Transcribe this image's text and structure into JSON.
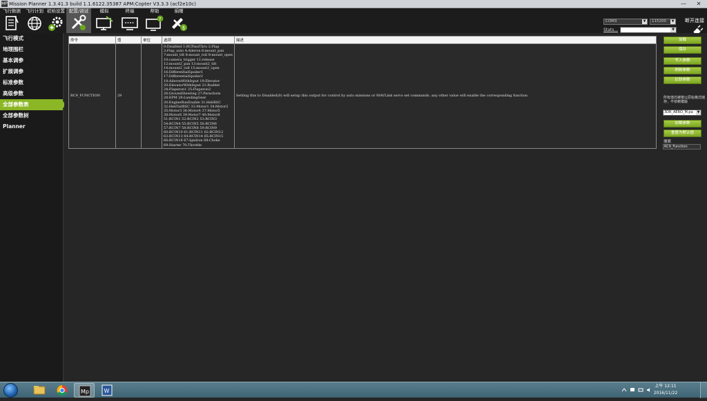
{
  "window": {
    "title": "Mission Planner 1.3.41.3 build 1.1.6122.35387 APM:Copter V3.3.3 (acf2e10c)",
    "app_icon": "MP",
    "min_glyph": "—",
    "close_glyph": "✕"
  },
  "menu": {
    "items": [
      {
        "label": "飞行数据",
        "icon": "flight-data-icon"
      },
      {
        "label": "飞行计划",
        "icon": "globe-icon"
      },
      {
        "label": "初始设置",
        "icon": "initial-setup-icon"
      },
      {
        "label": "配置/调试",
        "icon": "config-tuning-icon"
      },
      {
        "label": "模拟",
        "icon": "simulation-icon"
      },
      {
        "label": "终端",
        "icon": "terminal-icon"
      },
      {
        "label": "帮助",
        "icon": "help-icon"
      },
      {
        "label": "捐赠",
        "icon": "donate-icon"
      }
    ],
    "active_index": 3
  },
  "connection": {
    "port": "COM3",
    "baud": "115200",
    "stats_label": "Stats...",
    "disconnect_label": "断开连接"
  },
  "sidebar": {
    "items": [
      "飞行模式",
      "地理围栏",
      "基本调参",
      "扩展调参",
      "标准参数",
      "高级参数",
      "全部参数表",
      "全部参数树",
      "Planner"
    ],
    "active_index": 6
  },
  "table": {
    "headers": [
      "命令",
      "值",
      "单位",
      "选项",
      "描述"
    ],
    "rows": [
      {
        "command": "RC9_FUNCTION",
        "value": "29",
        "unit": "",
        "options": [
          "0:Disabled 1:RCPassThru 2:Flap",
          "3:Flap_auto 4:Aileron 6:mount_pan",
          "7:mount_tilt 8:mount_roll 9:mount_open",
          "10:camera_trigger 11:release",
          "12:mount2_pan 13:mount2_tilt",
          "14:mount2_roll 15:mount2_open",
          "16:DifferentialSpoiler1",
          "17:DifferentialSpoiler2",
          "18:AileronWithInput 19:Elevator",
          "20:ElevatorWithInput 21:Rudder",
          "24:Flaperon1 25:Flaperon2",
          "26:GroundSteering 27:Parachute",
          "28:EPM 29:LandingGear",
          "30:EngineRunEnable 31:HeliRSC",
          "32:HeliTailRSC 33:Motor1 34:Motor2",
          "35:Motor3 36:Motor4 37:Motor5",
          "38:Motor6 39:Motor7 40:Motor8",
          "51:RCIN1 52:RCIN2 53:RCIN3",
          "54:RCIN4 55:RCIN5 56:RCIN6",
          "57:RCIN7 58:RCIN8 59:RCIN9",
          "60:RCIN10 61:RCIN11 62:RCIN12",
          "63:RCIN13 64:RCIN14 65:RCIN15",
          "66:RCIN16 67:Ignition 68:Choke",
          "69:Starter 70:Throttle"
        ],
        "description": "Setting this to Disabled(0) will setup this output for control by auto missions or MAVLink servo set commands. any other value will enable the corresponding function"
      }
    ]
  },
  "right_panel": {
    "buttons_top": [
      "加载",
      "保存"
    ],
    "buttons_mid": [
      "写入参数",
      "刷新参数",
      "比较参数"
    ],
    "note": "所有值均被按以原始格式储存，不依赖模版",
    "param_file": "3DR_AERO_M.pa",
    "buttons_bottom": [
      "加载参数",
      "重置为默认值"
    ],
    "search_label": "搜索",
    "search_value": "RC9_Function"
  },
  "taskbar": {
    "apps": [
      "explorer-icon",
      "chrome-icon",
      "mission-planner-icon",
      "word-icon"
    ],
    "active_app_index": 2,
    "time": "上午 12:11",
    "date": "2016/11/22",
    "mp_text": "Mp",
    "word_text": "W"
  },
  "colors": {
    "accent_green": "#8bb626",
    "button_green": "#a7cc45",
    "background": "#262626"
  }
}
